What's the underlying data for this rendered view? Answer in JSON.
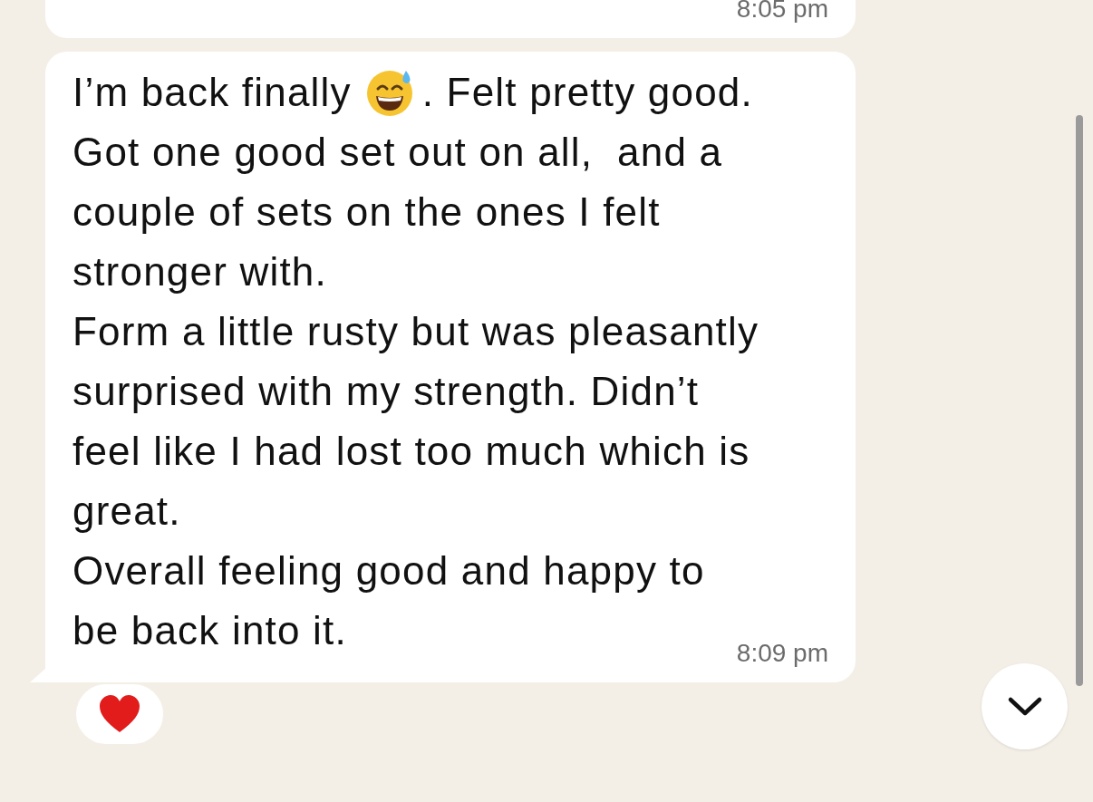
{
  "previous_message": {
    "time": "8:05 pm"
  },
  "message": {
    "lines": [
      [
        {
          "kind": "text",
          "text": "I’m back finally"
        },
        {
          "kind": "emoji"
        },
        {
          "kind": "text",
          "text": ". Felt pretty good."
        }
      ],
      [
        {
          "kind": "text",
          "text": "Got one good set out on all,  and a"
        }
      ],
      [
        {
          "kind": "text",
          "text": "couple of sets on the ones I felt"
        }
      ],
      [
        {
          "kind": "text",
          "text": "stronger with."
        }
      ],
      [
        {
          "kind": "text",
          "text": "Form a little rusty but was pleasantly"
        }
      ],
      [
        {
          "kind": "text",
          "text": "surprised with my strength. Didn’t"
        }
      ],
      [
        {
          "kind": "text",
          "text": "feel like I had lost too much which is"
        }
      ],
      [
        {
          "kind": "text",
          "text": "great."
        }
      ],
      [
        {
          "kind": "text",
          "text": "Overall feeling good and happy to"
        }
      ],
      [
        {
          "kind": "text",
          "text": "be back into it."
        }
      ]
    ],
    "time": "8:09 pm",
    "reactions": [
      {
        "kind": "heart"
      }
    ]
  }
}
